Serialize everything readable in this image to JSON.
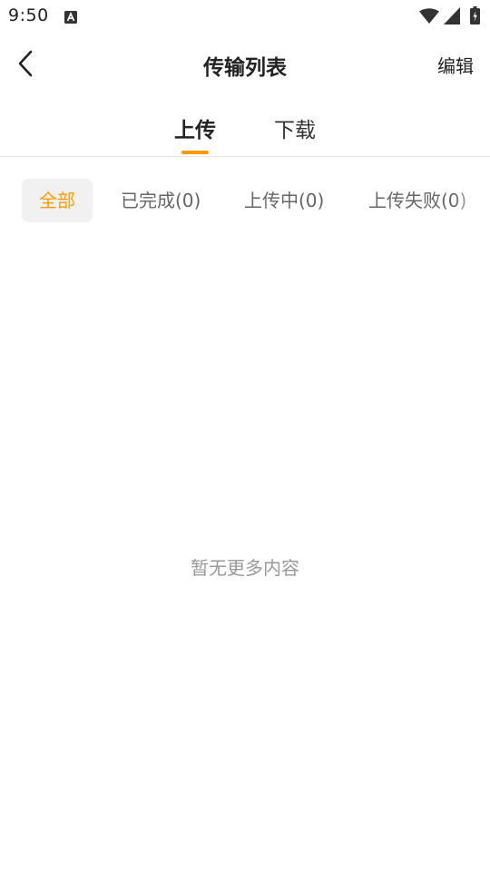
{
  "status_bar": {
    "time": "9:50",
    "icons": [
      "a-notification-icon",
      "wifi-icon",
      "signal-icon",
      "battery-icon"
    ]
  },
  "app_bar": {
    "title": "传输列表",
    "edit_label": "编辑",
    "back_icon": "back-chevron-icon"
  },
  "main_tabs": [
    {
      "label": "上传",
      "active": true
    },
    {
      "label": "下载",
      "active": false
    }
  ],
  "filters": [
    {
      "label": "全部",
      "selected": true
    },
    {
      "label": "已完成(0)",
      "selected": false
    },
    {
      "label": "上传中(0)",
      "selected": false
    },
    {
      "label": "上传失败(0)",
      "selected": false
    }
  ],
  "empty_state": {
    "message": "暂无更多内容"
  },
  "colors": {
    "accent": "#ff9900",
    "text_primary": "#222222",
    "text_secondary": "#666666",
    "text_muted": "#999999",
    "chip_bg": "#f1f1f1",
    "divider": "#e6e6e6"
  }
}
